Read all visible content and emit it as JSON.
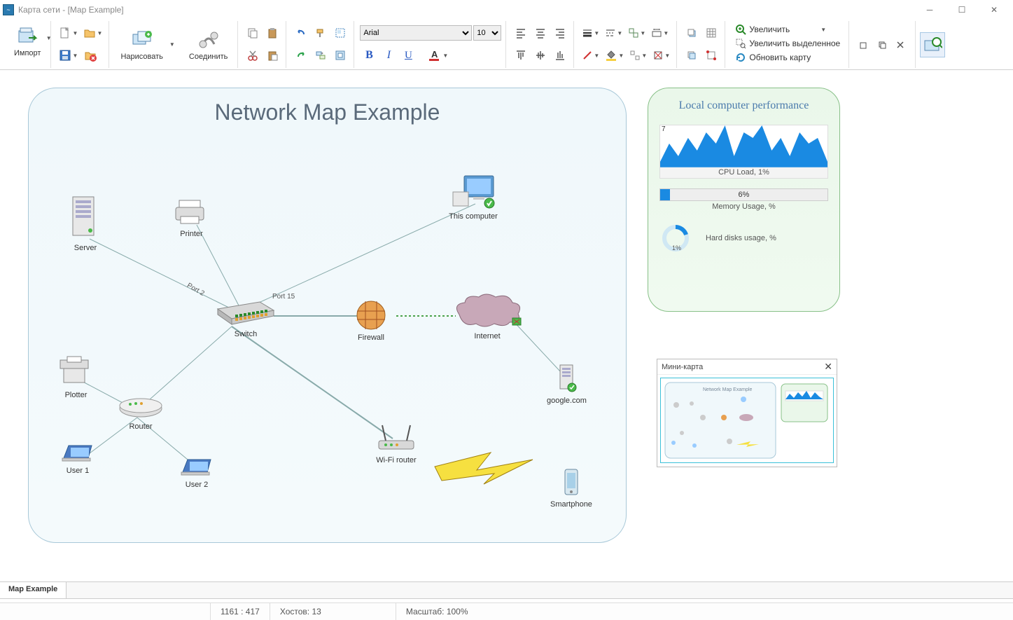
{
  "window": {
    "title": "Карта сети - [Map Example]"
  },
  "toolbar": {
    "import": "Импорт",
    "draw": "Нарисовать",
    "connect": "Соединить",
    "font_name": "Arial",
    "font_size": "10",
    "zoom_in": "Увеличить",
    "zoom_selection": "Увеличить выделенное",
    "refresh_map": "Обновить карту"
  },
  "map": {
    "title": "Network Map Example",
    "nodes": {
      "server": "Server",
      "printer": "Printer",
      "this_computer": "This computer",
      "switch": "Switch",
      "firewall": "Firewall",
      "internet": "Internet",
      "google": "google.com",
      "plotter": "Plotter",
      "router": "Router",
      "user1": "User 1",
      "user2": "User 2",
      "wifi": "Wi-Fi router",
      "smartphone": "Smartphone"
    },
    "ports": {
      "p2": "Port 2",
      "p15": "Port 15"
    }
  },
  "perf": {
    "title": "Local computer performance",
    "cpu_label": "CPU Load, 1%",
    "cpu_max": "7",
    "cpu_min": "0",
    "mem_pct": "6%",
    "mem_label": "Memory Usage, %",
    "disk_label": "Hard disks usage, %",
    "disk_pct": "1%"
  },
  "minimap": {
    "title": "Мини-карта"
  },
  "tabs": {
    "current": "Map Example"
  },
  "status": {
    "coords": "1161 : 417",
    "hosts": "Хостов: 13",
    "scale": "Масштаб: 100%"
  },
  "chart_data": {
    "type": "area",
    "title": "CPU Load, 1%",
    "ylabel": "",
    "xlabel": "",
    "ylim": [
      0,
      7
    ],
    "values": [
      1,
      4,
      2,
      5,
      3,
      6,
      4,
      7,
      2,
      6,
      5,
      7,
      3,
      5,
      2,
      6,
      4,
      5,
      1
    ]
  }
}
